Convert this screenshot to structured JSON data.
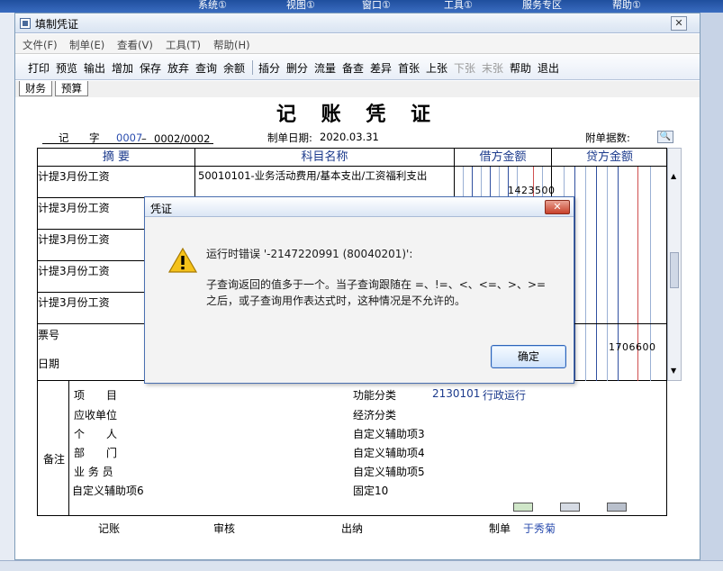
{
  "background_app": {
    "menu": [
      "系统①",
      "视图①",
      "窗口①",
      "工具①",
      "服务专区",
      "帮助①"
    ]
  },
  "window": {
    "title": "填制凭证",
    "close_glyph": "✕",
    "menu": [
      "文件(F)",
      "制单(E)",
      "查看(V)",
      "工具(T)",
      "帮助(H)"
    ],
    "toolbar": [
      {
        "label": "打印",
        "enabled": true
      },
      {
        "label": "预览",
        "enabled": true
      },
      {
        "label": "输出",
        "enabled": true
      },
      {
        "label": "增加",
        "enabled": true
      },
      {
        "label": "保存",
        "enabled": true
      },
      {
        "label": "放弃",
        "enabled": true
      },
      {
        "label": "查询",
        "enabled": true
      },
      {
        "label": "余额",
        "enabled": true
      },
      {
        "label": "插分",
        "enabled": true
      },
      {
        "label": "删分",
        "enabled": true
      },
      {
        "label": "流量",
        "enabled": true
      },
      {
        "label": "备查",
        "enabled": true
      },
      {
        "label": "差异",
        "enabled": true
      },
      {
        "label": "首张",
        "enabled": true
      },
      {
        "label": "上张",
        "enabled": true
      },
      {
        "label": "下张",
        "enabled": false
      },
      {
        "label": "末张",
        "enabled": false
      },
      {
        "label": "帮助",
        "enabled": true
      },
      {
        "label": "退出",
        "enabled": true
      }
    ],
    "tabs": [
      "财务",
      "预算"
    ]
  },
  "voucher": {
    "title": "记 账 凭 证",
    "type_label": "记",
    "no_label": "字",
    "no_value": "0007",
    "dash": "–",
    "page": "0002/0002",
    "date_label": "制单日期:",
    "date_value": "2020.03.31",
    "attach_label": "附单据数:",
    "columns": {
      "summary": "摘 要",
      "account": "科目名称",
      "debit": "借方金额",
      "credit": "贷方金额"
    },
    "rows": [
      {
        "summary": "计提3月份工资",
        "account": "50010101-业务活动费用/基本支出/工资福利支出",
        "debit": "1423500"
      },
      {
        "summary": "计提3月份工资",
        "account": "",
        "debit": ""
      },
      {
        "summary": "计提3月份工资",
        "account": "",
        "debit": ""
      },
      {
        "summary": "计提3月份工资",
        "account": "",
        "debit": ""
      },
      {
        "summary": "计提3月份工资",
        "account": "",
        "debit": ""
      }
    ],
    "ticket_label": "票号",
    "date_row_label": "日期",
    "total_credit": "1706600",
    "remarks": {
      "label": "备注",
      "left": [
        "项　　目",
        "应收单位",
        "个　　人",
        "部　　门",
        "业 务 员",
        "自定义辅助项6"
      ],
      "right": [
        "功能分类",
        "经济分类",
        "自定义辅助项3",
        "自定义辅助项4",
        "自定义辅助项5",
        "固定10"
      ],
      "function_code": "2130101",
      "function_name": "行政运行"
    },
    "signers": {
      "bookkeeper": "记账",
      "reviewer": "审核",
      "cashier": "出纳",
      "maker_label": "制单",
      "maker_name": "于秀菊"
    }
  },
  "dialog": {
    "title": "凭证",
    "close_glyph": "✕",
    "error_line": "运行时错误 '-2147220991 (80040201)':",
    "message_line1": "子查询返回的值多于一个。当子查询跟随在 =、!=、<、<=、>、>=",
    "message_line2": "之后，或子查询用作表达式时，这种情况是不允许的。",
    "ok_label": "确定"
  },
  "colors": {
    "accent_blue": "#1b3a8c",
    "link_blue": "#2a4cae",
    "dialog_border": "#4a6fb0"
  }
}
